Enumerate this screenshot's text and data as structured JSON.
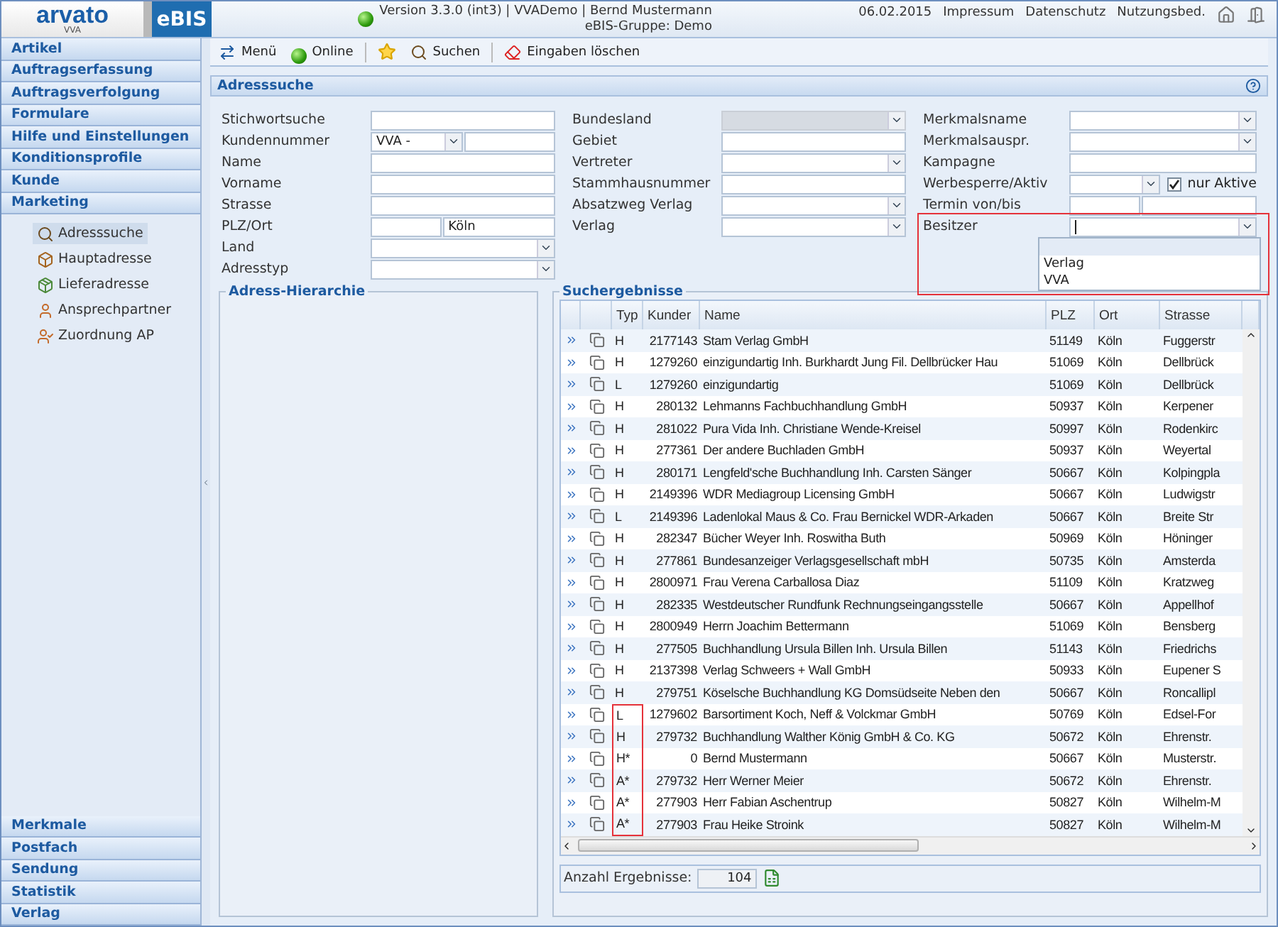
{
  "header": {
    "logo": "arvato",
    "logo_sub": "VVA",
    "product": "eBIS",
    "version": "Version 3.3.0 (int3) | VVADemo | Bernd Mustermann",
    "group": "eBIS-Gruppe: Demo",
    "date": "06.02.2015",
    "links": [
      "Impressum",
      "Datenschutz",
      "Nutzungsbed."
    ]
  },
  "sidebar": {
    "sections_top": [
      "Artikel",
      "Auftragserfassung",
      "Auftragsverfolgung",
      "Formulare",
      "Hilfe und Einstellungen",
      "Konditionsprofile",
      "Kunde",
      "Marketing"
    ],
    "items": [
      {
        "label": "Adresssuche",
        "kind": "search",
        "selected": true
      },
      {
        "label": "Hauptadresse",
        "kind": "box",
        "selected": false
      },
      {
        "label": "Lieferadresse",
        "kind": "package",
        "selected": false
      },
      {
        "label": "Ansprechpartner",
        "kind": "person",
        "selected": false
      },
      {
        "label": "Zuordnung AP",
        "kind": "person_link",
        "selected": false
      }
    ],
    "sections_bottom": [
      "Merkmale",
      "Postfach",
      "Sendung",
      "Statistik",
      "Verlag"
    ]
  },
  "toolbar": [
    {
      "kind": "menu",
      "label": "Menü"
    },
    {
      "kind": "status",
      "label": "Online"
    },
    {
      "kind": "favorite"
    },
    {
      "kind": "search",
      "label": "Suchen"
    },
    {
      "kind": "clear",
      "label": "Eingaben löschen"
    }
  ],
  "search_panel": {
    "title": "Adresssuche",
    "columns": [
      [
        {
          "label": "Stichwortsuche",
          "kind": "text",
          "disabled": false
        },
        {
          "label": "Kundennummer",
          "kind": "prefix",
          "value": "VVA -",
          "disabled": false
        },
        {
          "label": "Name",
          "kind": "text",
          "disabled": false
        },
        {
          "label": "Vorname",
          "kind": "text",
          "disabled": false
        },
        {
          "label": "Strasse",
          "kind": "text",
          "disabled": false
        },
        {
          "label": "PLZ/Ort",
          "kind": "split",
          "value_2": "Köln",
          "disabled": false
        },
        {
          "label": "Land",
          "kind": "select",
          "disabled": false
        },
        {
          "label": "Adresstyp",
          "kind": "select",
          "disabled": false
        }
      ],
      [
        {
          "label": "Bundesland",
          "kind": "select",
          "disabled": true
        },
        {
          "label": "Gebiet",
          "kind": "text",
          "disabled": false
        },
        {
          "label": "Vertreter",
          "kind": "select",
          "disabled": false
        },
        {
          "label": "Stammhausnummer",
          "kind": "text",
          "disabled": false
        },
        {
          "label": "Absatzweg Verlag",
          "kind": "select",
          "disabled": false
        },
        {
          "label": "Verlag",
          "kind": "select",
          "disabled": false
        }
      ],
      [
        {
          "label": "Merkmalsname",
          "kind": "select",
          "disabled": false
        },
        {
          "label": "Merkmalsauspr.",
          "kind": "select",
          "disabled": false
        },
        {
          "label": "Kampagne",
          "kind": "text",
          "disabled": false
        },
        {
          "label": "Werbesperre/Aktiv",
          "kind": "select_check",
          "check_label": "nur Aktive",
          "checked": true,
          "disabled": false
        },
        {
          "label": "Termin von/bis",
          "kind": "split",
          "disabled": false
        },
        {
          "label": "Besitzer",
          "kind": "select",
          "open": true,
          "marked": true,
          "options": [
            "Verlag",
            "VVA"
          ],
          "disabled": false
        }
      ]
    ]
  },
  "hierarchy_panel": {
    "title": "Adress-Hierarchie"
  },
  "results": {
    "title": "Suchergebnisse",
    "columns": [
      "Typ",
      "Kunder",
      "Name",
      "PLZ",
      "Ort",
      "Strasse"
    ],
    "rows": [
      {
        "typ": "H",
        "kunde": "2177143",
        "name": "Stam Verlag GmbH",
        "plz": "51149",
        "ort": "Köln",
        "strasse": "Fuggerstr",
        "marked": false
      },
      {
        "typ": "H",
        "kunde": "1279260",
        "name": "einzigundartig Inh. Burkhardt Jung Fil. Dellbrücker Hau",
        "plz": "51069",
        "ort": "Köln",
        "strasse": "Dellbrück",
        "marked": false
      },
      {
        "typ": "L",
        "kunde": "1279260",
        "name": "einzigundartig",
        "plz": "51069",
        "ort": "Köln",
        "strasse": "Dellbrück",
        "marked": false
      },
      {
        "typ": "H",
        "kunde": "280132",
        "name": "Lehmanns Fachbuchhandlung GmbH",
        "plz": "50937",
        "ort": "Köln",
        "strasse": "Kerpener",
        "marked": false
      },
      {
        "typ": "H",
        "kunde": "281022",
        "name": "Pura Vida Inh. Christiane Wende-Kreisel",
        "plz": "50997",
        "ort": "Köln",
        "strasse": "Rodenkirc",
        "marked": false
      },
      {
        "typ": "H",
        "kunde": "277361",
        "name": "Der andere Buchladen GmbH",
        "plz": "50937",
        "ort": "Köln",
        "strasse": "Weyertal",
        "marked": false
      },
      {
        "typ": "H",
        "kunde": "280171",
        "name": "Lengfeld'sche Buchhandlung Inh. Carsten Sänger",
        "plz": "50667",
        "ort": "Köln",
        "strasse": "Kolpingpla",
        "marked": false
      },
      {
        "typ": "H",
        "kunde": "2149396",
        "name": "WDR Mediagroup Licensing GmbH",
        "plz": "50667",
        "ort": "Köln",
        "strasse": "Ludwigstr",
        "marked": false
      },
      {
        "typ": "L",
        "kunde": "2149396",
        "name": "Ladenlokal Maus & Co. Frau Bernickel WDR-Arkaden",
        "plz": "50667",
        "ort": "Köln",
        "strasse": "Breite Str",
        "marked": false
      },
      {
        "typ": "H",
        "kunde": "282347",
        "name": "Bücher Weyer Inh. Roswitha Buth",
        "plz": "50969",
        "ort": "Köln",
        "strasse": "Höninger",
        "marked": false
      },
      {
        "typ": "H",
        "kunde": "277861",
        "name": "Bundesanzeiger Verlagsgesellschaft mbH",
        "plz": "50735",
        "ort": "Köln",
        "strasse": "Amsterda",
        "marked": false
      },
      {
        "typ": "H",
        "kunde": "2800971",
        "name": "Frau Verena Carballosa Diaz",
        "plz": "51109",
        "ort": "Köln",
        "strasse": "Kratzweg",
        "marked": false
      },
      {
        "typ": "H",
        "kunde": "282335",
        "name": "Westdeutscher Rundfunk Rechnungseingangsstelle",
        "plz": "50667",
        "ort": "Köln",
        "strasse": "Appellhof",
        "marked": false
      },
      {
        "typ": "H",
        "kunde": "2800949",
        "name": "Herrn Joachim Bettermann",
        "plz": "51069",
        "ort": "Köln",
        "strasse": "Bensberg",
        "marked": false
      },
      {
        "typ": "H",
        "kunde": "277505",
        "name": "Buchhandlung Ursula Billen Inh. Ursula Billen",
        "plz": "51143",
        "ort": "Köln",
        "strasse": "Friedrichs",
        "marked": false
      },
      {
        "typ": "H",
        "kunde": "2137398",
        "name": "Verlag Schweers + Wall GmbH",
        "plz": "50933",
        "ort": "Köln",
        "strasse": "Eupener S",
        "marked": false
      },
      {
        "typ": "H",
        "kunde": "279751",
        "name": "Köselsche Buchhandlung KG Domsüdseite Neben den",
        "plz": "50667",
        "ort": "Köln",
        "strasse": "Roncallipl",
        "marked": false
      },
      {
        "typ": "L",
        "kunde": "1279602",
        "name": "Barsortiment Koch, Neff & Volckmar GmbH",
        "plz": "50769",
        "ort": "Köln",
        "strasse": "Edsel-For",
        "marked": true
      },
      {
        "typ": "H",
        "kunde": "279732",
        "name": "Buchhandlung Walther König GmbH & Co. KG",
        "plz": "50672",
        "ort": "Köln",
        "strasse": "Ehrenstr.",
        "marked": true
      },
      {
        "typ": "H*",
        "kunde": "0",
        "name": "Bernd Mustermann",
        "plz": "50667",
        "ort": "Köln",
        "strasse": "Musterstr.",
        "marked": true
      },
      {
        "typ": "A*",
        "kunde": "279732",
        "name": "Herr Werner Meier",
        "plz": "50672",
        "ort": "Köln",
        "strasse": "Ehrenstr.",
        "marked": true
      },
      {
        "typ": "A*",
        "kunde": "277903",
        "name": "Herr Fabian Aschentrup",
        "plz": "50827",
        "ort": "Köln",
        "strasse": "Wilhelm-M",
        "marked": true
      },
      {
        "typ": "A*",
        "kunde": "277903",
        "name": "Frau Heike Stroink",
        "plz": "50827",
        "ort": "Köln",
        "strasse": "Wilhelm-M",
        "marked": true
      }
    ],
    "count_label": "Anzahl Ergebnisse:",
    "count": "104"
  }
}
